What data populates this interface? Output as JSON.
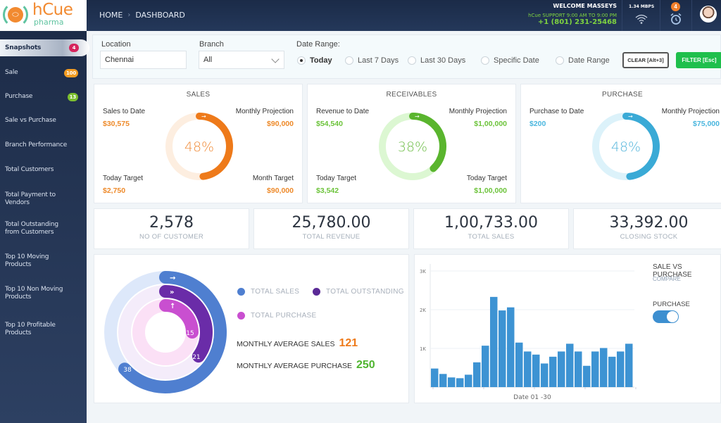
{
  "app": {
    "logo_name": "hCue",
    "logo_sub": "pharma"
  },
  "header": {
    "breadcrumb": [
      "HOME",
      "DASHBOARD"
    ],
    "welcome": "WELCOME MASSEYS",
    "support": "hCue SUPPORT 9:00 AM TO 9:00 PM",
    "phone": "+1 (801) 231-25468",
    "speed": "1.34 MBPS",
    "notification_count": "4",
    "icons": [
      "wifi-icon",
      "alarm-clock-icon",
      "avatar"
    ]
  },
  "sidebar": {
    "items": [
      {
        "label": "Snapshots",
        "badge": "4",
        "badge_color": "#d6245c",
        "active": true
      },
      {
        "label": "Sale",
        "badge": "100",
        "badge_color": "#f39c22"
      },
      {
        "label": "Purchase",
        "badge": "13",
        "badge_color": "#7cbf2e"
      },
      {
        "label": "Sale vs Purchase"
      },
      {
        "label": "Branch Performance"
      },
      {
        "label": "Total Customers"
      },
      {
        "label": "Total Payment to Vendors"
      },
      {
        "label": "Total Outstanding from Customers"
      },
      {
        "label": "Top 10 Moving Products"
      },
      {
        "label": "Top 10 Non Moving Products"
      },
      {
        "label": "Top 10 Profitable Products"
      }
    ]
  },
  "filters": {
    "location_label": "Location",
    "location_value": "Chennai",
    "branch_label": "Branch",
    "branch_value": "All",
    "date_range_label": "Date Range:",
    "date_options": [
      "Today",
      "Last 7 Days",
      "Last 30 Days",
      "Specific Date",
      "Date Range"
    ],
    "selected_option": "Today",
    "clear_label": "CLEAR [Alt+3]",
    "filter_label": "FILTER [Esc]"
  },
  "summary_cards": [
    {
      "title": "SALES",
      "color": "#ee7a1a",
      "track": "#fdeee0",
      "percent": 48,
      "percent_label": "48%",
      "tl_label": "Sales to Date",
      "tl_value": "$30,575",
      "tr_label": "Monthly Projection",
      "tr_value": "$90,000",
      "bl_label": "Today Target",
      "bl_value": "$2,750",
      "br_label": "Month Target",
      "br_value": "$90,000"
    },
    {
      "title": "RECEIVABLES",
      "color": "#5ab52e",
      "track": "#dcf7d2",
      "percent": 38,
      "percent_label": "38%",
      "tl_label": "Revenue to Date",
      "tl_value": "$54,540",
      "tr_label": "Monthly Projection",
      "tr_value": "$1,00,000",
      "bl_label": "Today Target",
      "bl_value": "$3,542",
      "br_label": "Today Target",
      "br_value": "$1,00,000"
    },
    {
      "title": "PURCHASE",
      "color": "#3aaad6",
      "track": "#dcf2fa",
      "percent": 48,
      "percent_label": "48%",
      "tl_label": "Purchase to Date",
      "tl_value": "$200",
      "tr_label": "Monthly Projection",
      "tr_value": "$75,000"
    }
  ],
  "stats": [
    {
      "value": "2,578",
      "label": "NO OF CUSTOMER"
    },
    {
      "value": "25,780.00",
      "label": "TOTAL REVENUE"
    },
    {
      "value": "1,00,733.00",
      "label": "TOTAL SALES"
    },
    {
      "value": "33,392.00",
      "label": "CLOSING STOCK"
    }
  ],
  "radial": {
    "rings": [
      {
        "name": "TOTAL SALES",
        "value": 38,
        "color": "#4f7fd0",
        "track": "#dde8fa",
        "icon": "arrow-right-icon"
      },
      {
        "name": "TOTAL OUTSTANDING",
        "value": 21,
        "color": "#6a2ca8",
        "track": "#f4ecfa",
        "icon": "double-arrow-right-icon"
      },
      {
        "name": "TOTAL PURCHASE",
        "value": 15,
        "color": "#c94fd0",
        "track": "#fbe0f6",
        "icon": "arrow-up-icon"
      }
    ],
    "monthly_avg_sales_label": "MONTHLY AVERAGE SALES",
    "monthly_avg_sales": "121",
    "monthly_avg_purchase_label": "MONTHLY AVERAGE PURCHASE",
    "monthly_avg_purchase": "250"
  },
  "compare": {
    "title": "SALE VS PURCHASE",
    "subtitle": "COMPARE",
    "toggle_label": "PURCHASE",
    "toggle_on": true
  },
  "chart_data": {
    "type": "bar",
    "title": "",
    "xlabel": "Date 01 -30",
    "ylabel": "",
    "ylim": [
      0,
      3000
    ],
    "yticks": [
      "1K",
      "2K",
      "3K"
    ],
    "grid": true,
    "color": "#3d93d3",
    "values": [
      480,
      340,
      250,
      230,
      320,
      640,
      1070,
      2330,
      1980,
      2060,
      1150,
      920,
      840,
      610,
      785,
      920,
      1120,
      920,
      550,
      920,
      1010,
      785,
      920,
      1120
    ]
  }
}
